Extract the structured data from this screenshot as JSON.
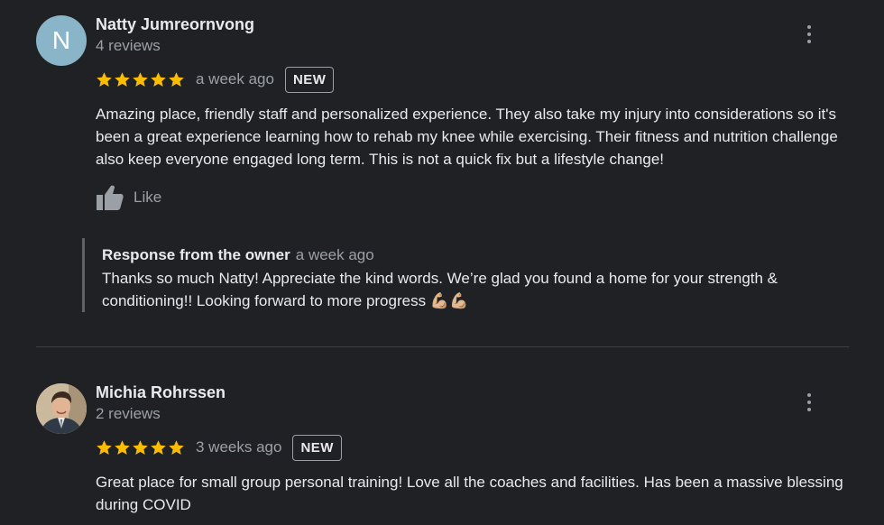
{
  "reviews": [
    {
      "avatar_letter": "N",
      "avatar_color": "#8ab4c8",
      "name": "Natty Jumreornvong",
      "review_count": "4 reviews",
      "rating": 5,
      "date": "a week ago",
      "badge": "NEW",
      "text": "Amazing place, friendly staff and personalized experience. They also take my injury into considerations so it's been a great experience learning how to rehab my knee while exercising. Their fitness and nutrition challenge also keep everyone engaged long term. This is not a quick fix but a lifestyle change!",
      "like_label": "Like",
      "owner_response": {
        "title": "Response from the owner",
        "date": "a week ago",
        "text": "Thanks so much Natty! Appreciate the kind words. We’re glad you found a home for your strength & conditioning!! Looking forward to more progress 💪🏼💪🏼"
      }
    },
    {
      "avatar_icon": "profile-photo",
      "name": "Michia Rohrssen",
      "review_count": "2 reviews",
      "rating": 5,
      "date": "3 weeks ago",
      "badge": "NEW",
      "text": "Great place for small group personal training! Love all the coaches and facilities. Has been a massive blessing during COVID"
    }
  ],
  "icons": {
    "star": "star-icon",
    "like": "thumbs-up-icon",
    "more": "more-vert-icon"
  },
  "colors": {
    "background": "#202124",
    "star": "#fbbc04",
    "text_primary": "#e8eaed",
    "text_secondary": "#9aa0a6",
    "divider": "#3c4043"
  }
}
